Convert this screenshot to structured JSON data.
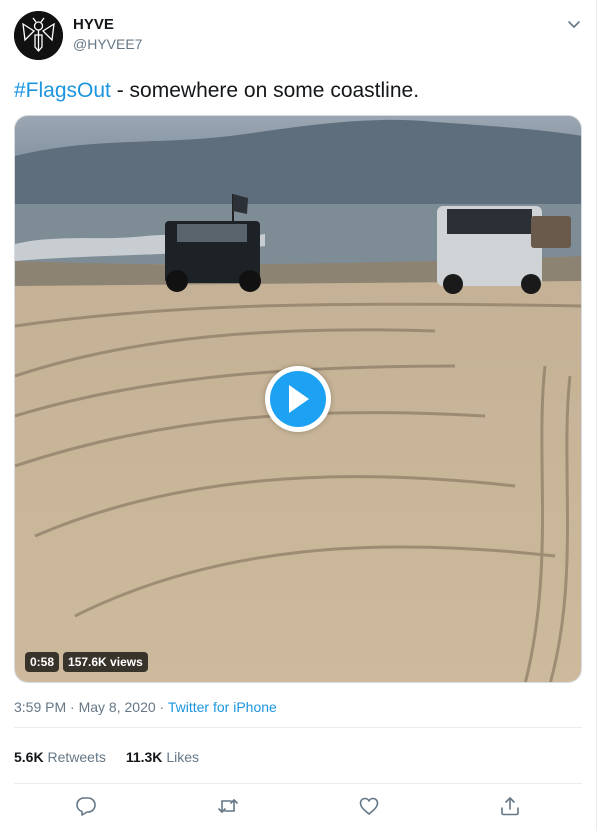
{
  "author": {
    "name": "HYVE",
    "handle": "@HYVEE7"
  },
  "tweet": {
    "hashtag": "#FlagsOut",
    "text": " - somewhere on some coastline."
  },
  "video": {
    "duration": "0:58",
    "views": "157.6K views"
  },
  "meta": {
    "time": "3:59 PM",
    "separator": " · ",
    "date": "May 8, 2020",
    "source": "Twitter for iPhone"
  },
  "stats": {
    "retweets_count": "5.6K",
    "retweets_label": "Retweets",
    "likes_count": "11.3K",
    "likes_label": "Likes"
  },
  "colors": {
    "link": "#1b95e0",
    "accent": "#1da1f2",
    "secondary_text": "#657786"
  },
  "icons": [
    "reply-icon",
    "retweet-icon",
    "like-icon",
    "share-icon",
    "chevron-down-icon",
    "play-icon"
  ]
}
